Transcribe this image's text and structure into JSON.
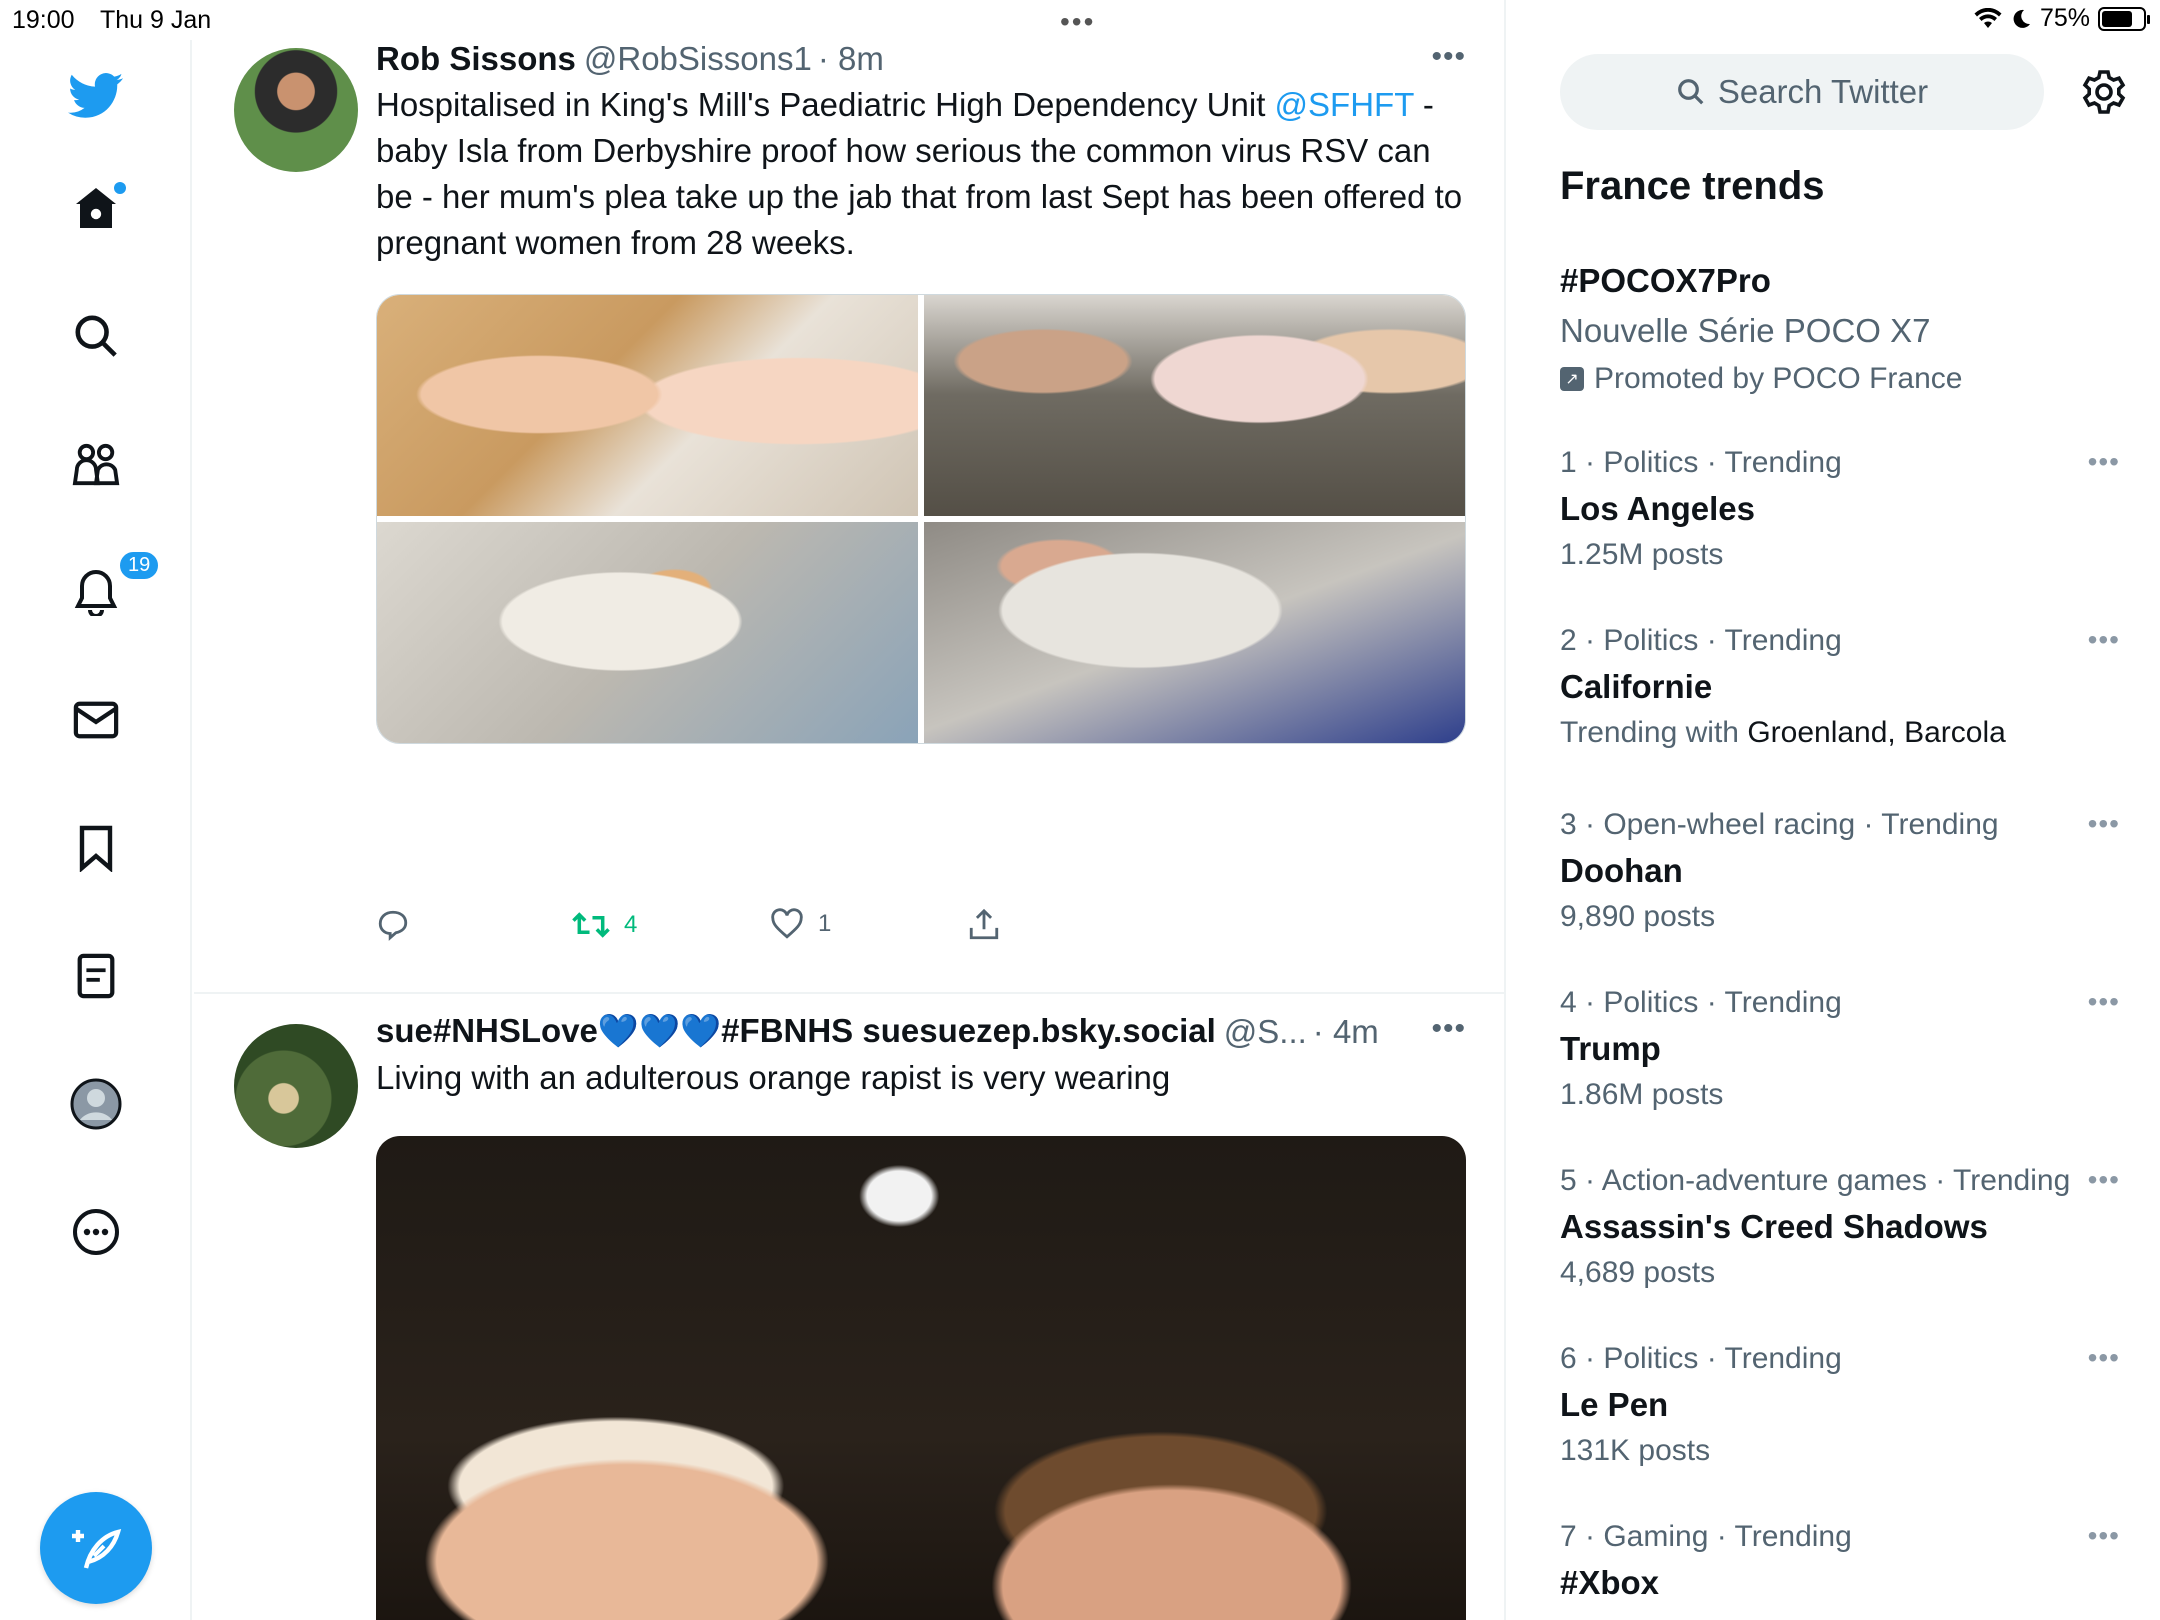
{
  "status_bar": {
    "time": "19:00",
    "date": "Thu 9 Jan",
    "battery": "75%",
    "battery_level": 0.75
  },
  "nav": {
    "notifications_count": "19"
  },
  "tweets": [
    {
      "name": "Rob Sissons",
      "handle": "@RobSissons1",
      "time": "· 8m",
      "text_before": "Hospitalised in King's Mill's Paediatric High Dependency Unit ",
      "mention": "@SFHFT",
      "text_after": " - baby Isla from Derbyshire proof how serious the common virus RSV can be - her mum's plea take up the jab that from last Sept has been offered to pregnant women from 28 weeks.",
      "retweets": "4",
      "likes": "1"
    },
    {
      "name": "sue#NHSLove💙💙💙#FBNHS suesuezep.bsky.social",
      "handle": "@S...",
      "time": "· 4m",
      "text": "Living with an adulterous orange rapist is very wearing"
    }
  ],
  "sidebar": {
    "search_placeholder": "Search Twitter",
    "trends_title": "France trends",
    "promoted": {
      "name": "#POCOX7Pro",
      "description": "Nouvelle Série POCO X7",
      "by": "Promoted by POCO France"
    },
    "trends": [
      {
        "meta": "1 · Politics · Trending",
        "name": "Los Angeles",
        "sub": "1.25M posts"
      },
      {
        "meta": "2 · Politics · Trending",
        "name": "Californie",
        "sub_prefix": "Trending with ",
        "sub_bold": "Groenland, Barcola"
      },
      {
        "meta": "3 · Open-wheel racing · Trending",
        "name": "Doohan",
        "sub": "9,890 posts"
      },
      {
        "meta": "4 · Politics · Trending",
        "name": "Trump",
        "sub": "1.86M posts"
      },
      {
        "meta": "5 · Action-adventure games · Trending",
        "name": "Assassin's Creed Shadows",
        "sub": "4,689 posts"
      },
      {
        "meta": "6 · Politics · Trending",
        "name": "Le Pen",
        "sub": "131K posts"
      },
      {
        "meta": "7 · Gaming · Trending",
        "name": "#Xbox",
        "sub": ""
      }
    ]
  },
  "colors": {
    "accent": "#1d9bf0",
    "retweet": "#00ba7c",
    "secondary_text": "#536471"
  }
}
